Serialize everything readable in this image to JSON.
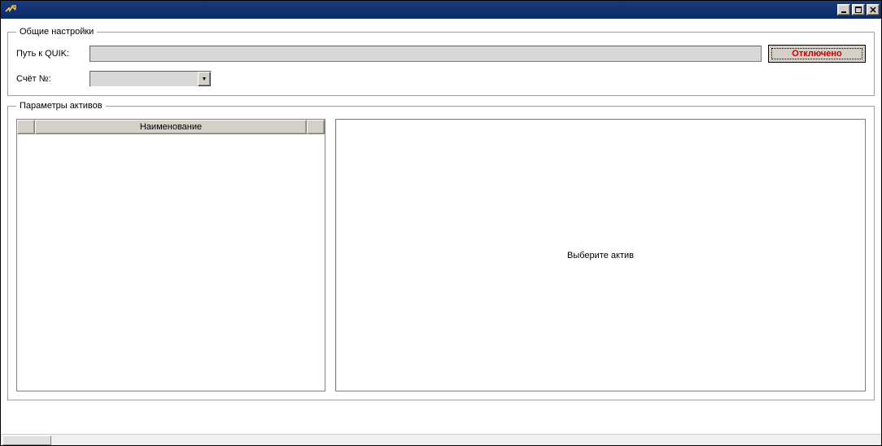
{
  "window": {
    "title": ""
  },
  "general": {
    "legend": "Общие настройки",
    "path_label": "Путь к QUIK:",
    "path_value": "",
    "disconnect_label": "Отключено",
    "account_label": "Счёт №:",
    "account_value": ""
  },
  "assets": {
    "legend": "Параметры активов",
    "name_col": "Наименование",
    "detail_placeholder": "Выберите актив"
  }
}
